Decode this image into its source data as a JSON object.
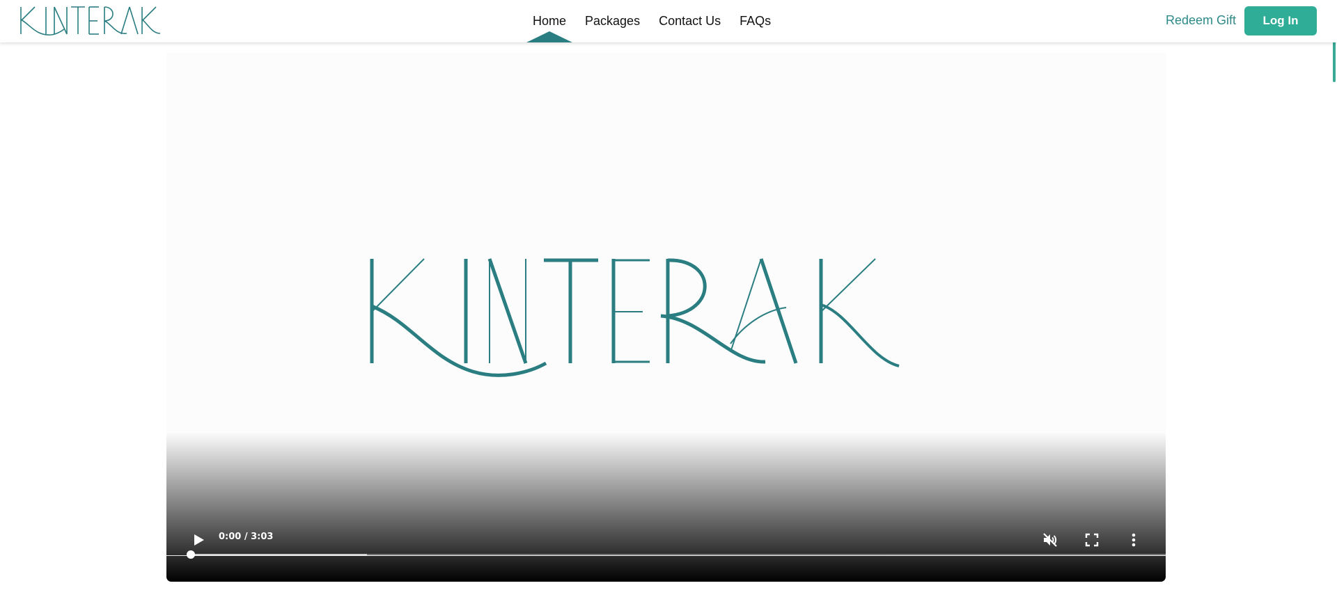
{
  "brand": {
    "logo_text": "KINTERAK",
    "color": "#2a7d80"
  },
  "nav": {
    "items": [
      {
        "label": "Home",
        "active": true
      },
      {
        "label": "Packages",
        "active": false
      },
      {
        "label": "Contact Us",
        "active": false
      },
      {
        "label": "FAQs",
        "active": false
      }
    ]
  },
  "actions": {
    "redeem_label": "Redeem Gift",
    "login_label": "Log In",
    "login_color": "#30ad97"
  },
  "video": {
    "logo_text": "KINTERAK",
    "time_display": "0:00 / 3:03",
    "progress_fraction": 0.0,
    "buffered_fraction": 0.18,
    "muted": true,
    "icons": [
      "play-icon",
      "mute-icon",
      "fullscreen-icon",
      "more-options-icon"
    ]
  }
}
